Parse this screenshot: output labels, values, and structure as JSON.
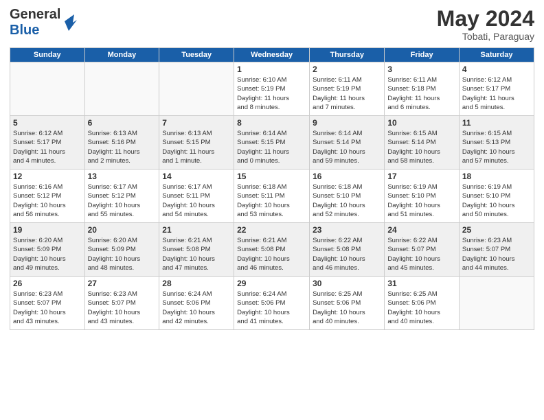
{
  "header": {
    "logo_line1": "General",
    "logo_line2": "Blue",
    "month": "May 2024",
    "location": "Tobati, Paraguay"
  },
  "weekdays": [
    "Sunday",
    "Monday",
    "Tuesday",
    "Wednesday",
    "Thursday",
    "Friday",
    "Saturday"
  ],
  "weeks": [
    [
      {
        "day": "",
        "info": ""
      },
      {
        "day": "",
        "info": ""
      },
      {
        "day": "",
        "info": ""
      },
      {
        "day": "1",
        "info": "Sunrise: 6:10 AM\nSunset: 5:19 PM\nDaylight: 11 hours\nand 8 minutes."
      },
      {
        "day": "2",
        "info": "Sunrise: 6:11 AM\nSunset: 5:19 PM\nDaylight: 11 hours\nand 7 minutes."
      },
      {
        "day": "3",
        "info": "Sunrise: 6:11 AM\nSunset: 5:18 PM\nDaylight: 11 hours\nand 6 minutes."
      },
      {
        "day": "4",
        "info": "Sunrise: 6:12 AM\nSunset: 5:17 PM\nDaylight: 11 hours\nand 5 minutes."
      }
    ],
    [
      {
        "day": "5",
        "info": "Sunrise: 6:12 AM\nSunset: 5:17 PM\nDaylight: 11 hours\nand 4 minutes."
      },
      {
        "day": "6",
        "info": "Sunrise: 6:13 AM\nSunset: 5:16 PM\nDaylight: 11 hours\nand 2 minutes."
      },
      {
        "day": "7",
        "info": "Sunrise: 6:13 AM\nSunset: 5:15 PM\nDaylight: 11 hours\nand 1 minute."
      },
      {
        "day": "8",
        "info": "Sunrise: 6:14 AM\nSunset: 5:15 PM\nDaylight: 11 hours\nand 0 minutes."
      },
      {
        "day": "9",
        "info": "Sunrise: 6:14 AM\nSunset: 5:14 PM\nDaylight: 10 hours\nand 59 minutes."
      },
      {
        "day": "10",
        "info": "Sunrise: 6:15 AM\nSunset: 5:14 PM\nDaylight: 10 hours\nand 58 minutes."
      },
      {
        "day": "11",
        "info": "Sunrise: 6:15 AM\nSunset: 5:13 PM\nDaylight: 10 hours\nand 57 minutes."
      }
    ],
    [
      {
        "day": "12",
        "info": "Sunrise: 6:16 AM\nSunset: 5:12 PM\nDaylight: 10 hours\nand 56 minutes."
      },
      {
        "day": "13",
        "info": "Sunrise: 6:17 AM\nSunset: 5:12 PM\nDaylight: 10 hours\nand 55 minutes."
      },
      {
        "day": "14",
        "info": "Sunrise: 6:17 AM\nSunset: 5:11 PM\nDaylight: 10 hours\nand 54 minutes."
      },
      {
        "day": "15",
        "info": "Sunrise: 6:18 AM\nSunset: 5:11 PM\nDaylight: 10 hours\nand 53 minutes."
      },
      {
        "day": "16",
        "info": "Sunrise: 6:18 AM\nSunset: 5:10 PM\nDaylight: 10 hours\nand 52 minutes."
      },
      {
        "day": "17",
        "info": "Sunrise: 6:19 AM\nSunset: 5:10 PM\nDaylight: 10 hours\nand 51 minutes."
      },
      {
        "day": "18",
        "info": "Sunrise: 6:19 AM\nSunset: 5:10 PM\nDaylight: 10 hours\nand 50 minutes."
      }
    ],
    [
      {
        "day": "19",
        "info": "Sunrise: 6:20 AM\nSunset: 5:09 PM\nDaylight: 10 hours\nand 49 minutes."
      },
      {
        "day": "20",
        "info": "Sunrise: 6:20 AM\nSunset: 5:09 PM\nDaylight: 10 hours\nand 48 minutes."
      },
      {
        "day": "21",
        "info": "Sunrise: 6:21 AM\nSunset: 5:08 PM\nDaylight: 10 hours\nand 47 minutes."
      },
      {
        "day": "22",
        "info": "Sunrise: 6:21 AM\nSunset: 5:08 PM\nDaylight: 10 hours\nand 46 minutes."
      },
      {
        "day": "23",
        "info": "Sunrise: 6:22 AM\nSunset: 5:08 PM\nDaylight: 10 hours\nand 46 minutes."
      },
      {
        "day": "24",
        "info": "Sunrise: 6:22 AM\nSunset: 5:07 PM\nDaylight: 10 hours\nand 45 minutes."
      },
      {
        "day": "25",
        "info": "Sunrise: 6:23 AM\nSunset: 5:07 PM\nDaylight: 10 hours\nand 44 minutes."
      }
    ],
    [
      {
        "day": "26",
        "info": "Sunrise: 6:23 AM\nSunset: 5:07 PM\nDaylight: 10 hours\nand 43 minutes."
      },
      {
        "day": "27",
        "info": "Sunrise: 6:23 AM\nSunset: 5:07 PM\nDaylight: 10 hours\nand 43 minutes."
      },
      {
        "day": "28",
        "info": "Sunrise: 6:24 AM\nSunset: 5:06 PM\nDaylight: 10 hours\nand 42 minutes."
      },
      {
        "day": "29",
        "info": "Sunrise: 6:24 AM\nSunset: 5:06 PM\nDaylight: 10 hours\nand 41 minutes."
      },
      {
        "day": "30",
        "info": "Sunrise: 6:25 AM\nSunset: 5:06 PM\nDaylight: 10 hours\nand 40 minutes."
      },
      {
        "day": "31",
        "info": "Sunrise: 6:25 AM\nSunset: 5:06 PM\nDaylight: 10 hours\nand 40 minutes."
      },
      {
        "day": "",
        "info": ""
      }
    ]
  ]
}
